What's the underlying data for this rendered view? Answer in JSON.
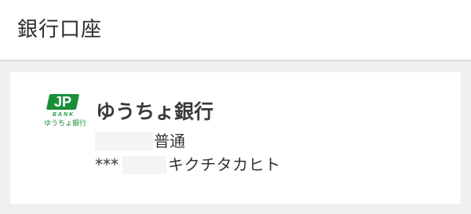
{
  "header": {
    "title": "銀行口座"
  },
  "bank_account": {
    "logo": {
      "mark_text": "JP",
      "bank_word": "BANK",
      "name": "ゆうちょ銀行",
      "color": "#1a8f3a"
    },
    "bank_name": "ゆうちょ銀行",
    "account_type": "普通",
    "account_number_prefix": "***",
    "account_holder": "キクチタカヒト"
  }
}
